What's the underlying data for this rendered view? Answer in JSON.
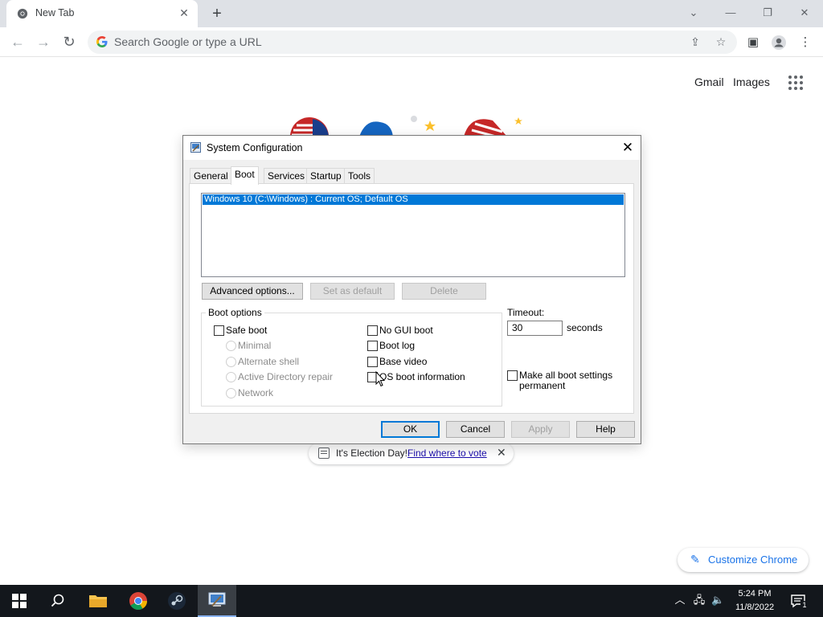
{
  "browser": {
    "tab_title": "New Tab",
    "tab_close_icon": "close-icon",
    "new_tab_icon": "plus-icon",
    "window_controls": [
      "chevron-down-icon",
      "minimize-icon",
      "restore-icon",
      "close-icon"
    ],
    "omnibox_placeholder": "Search Google or type a URL",
    "toolbar_icons": [
      "back-icon",
      "forward-icon",
      "reload-icon",
      "share-icon",
      "star-icon",
      "side-panel-icon",
      "profile-icon",
      "menu-icon"
    ]
  },
  "ntp": {
    "gmail": "Gmail",
    "images": "Images",
    "customize_label": "Customize Chrome",
    "election_text": "It's Election Day!",
    "election_link": "Find where to vote"
  },
  "dialog": {
    "title": "System Configuration",
    "tabs": [
      "General",
      "Boot",
      "Services",
      "Startup",
      "Tools"
    ],
    "active_tab": "Boot",
    "os_entries": [
      "Windows 10 (C:\\Windows) : Current OS; Default OS"
    ],
    "buttons": {
      "advanced": "Advanced options...",
      "set_default": "Set as default",
      "delete": "Delete",
      "ok": "OK",
      "cancel": "Cancel",
      "apply": "Apply",
      "help": "Help"
    },
    "boot_options": {
      "group_label": "Boot options",
      "safe_boot": "Safe boot",
      "minimal": "Minimal",
      "alternate_shell": "Alternate shell",
      "ad_repair": "Active Directory repair",
      "network": "Network",
      "no_gui_boot": "No GUI boot",
      "boot_log": "Boot log",
      "base_video": "Base video",
      "os_boot_info": "OS boot information"
    },
    "timeout": {
      "label": "Timeout:",
      "value": "30",
      "unit": "seconds"
    },
    "make_permanent_line1": "Make all boot settings",
    "make_permanent_line2": "permanent"
  },
  "taskbar": {
    "time": "5:24 PM",
    "date": "11/8/2022",
    "notification_count": "1",
    "apps": [
      "start-icon",
      "search-icon",
      "file-explorer-icon",
      "chrome-icon",
      "steam-icon",
      "msconfig-icon"
    ]
  }
}
